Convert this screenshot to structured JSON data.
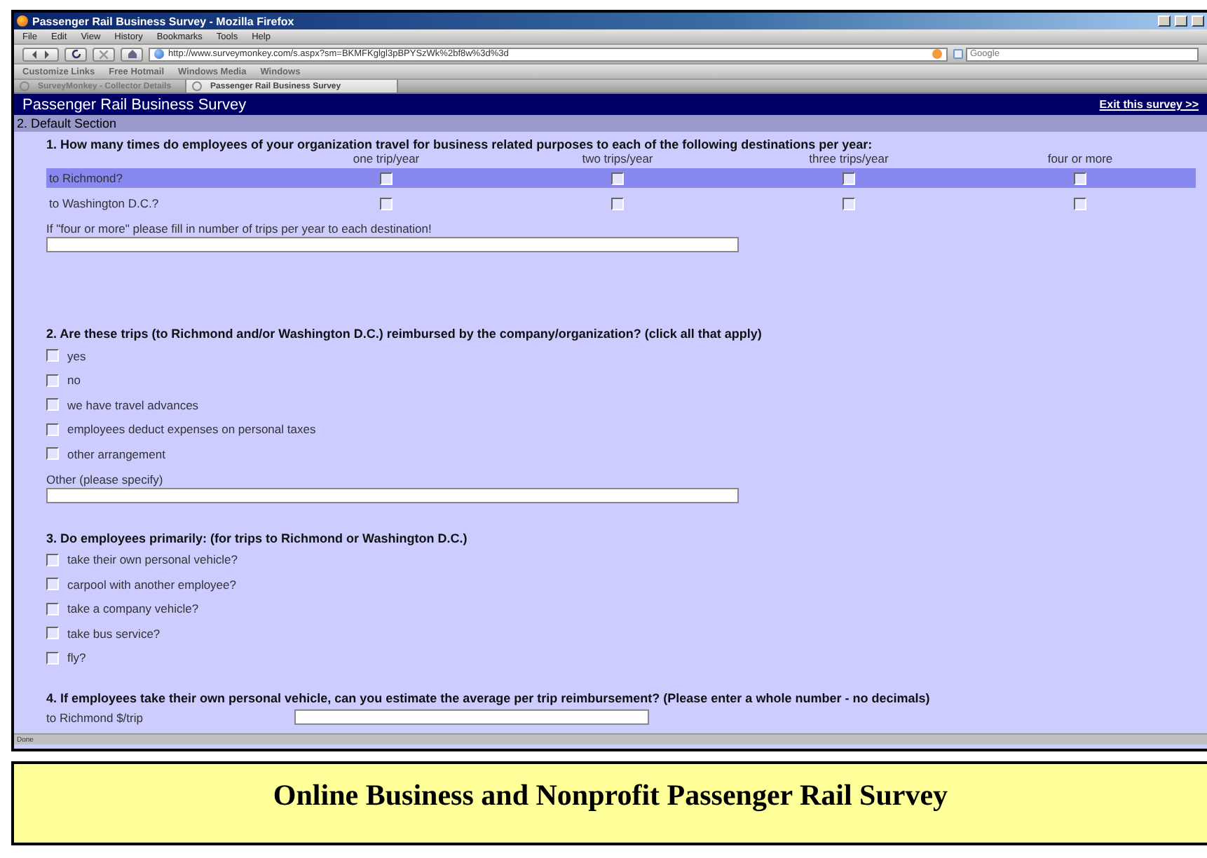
{
  "browser": {
    "title": "Passenger Rail Business Survey - Mozilla Firefox",
    "menu": [
      "File",
      "Edit",
      "View",
      "History",
      "Bookmarks",
      "Tools",
      "Help"
    ],
    "url": "http://www.surveymonkey.com/s.aspx?sm=BKMFKglgl3pBPYSzWk%2bf8w%3d%3d",
    "search_placeholder": "Google",
    "bookmarks": [
      "Customize Links",
      "Free Hotmail",
      "Windows Media",
      "Windows"
    ],
    "tabs": [
      {
        "label": "SurveyMonkey - Collector Details",
        "selected": false
      },
      {
        "label": "Passenger Rail Business Survey",
        "selected": true
      }
    ],
    "status": "Done"
  },
  "survey": {
    "title": "Passenger Rail Business Survey",
    "exit_link": "Exit this survey >>",
    "section": "2. Default Section",
    "questions": [
      {
        "kind": "matrix",
        "text": "1. How many times do employees of your organization travel for business related purposes to each of the following destinations per year:",
        "columns": [
          "one trip/year",
          "two trips/year",
          "three trips/year",
          "four or more"
        ],
        "rows": [
          {
            "label": "to Richmond?",
            "highlighted": true,
            "cells": [
              {
                "checked": false
              },
              {
                "checked": false
              },
              {
                "checked": false
              },
              {
                "checked": false
              }
            ]
          },
          {
            "label": "to Washington D.C.?",
            "highlighted": false,
            "cells": [
              {
                "checked": false
              },
              {
                "checked": false
              },
              {
                "checked": false
              },
              {
                "checked": false
              }
            ]
          }
        ],
        "field_label": "If \"four or more\" please fill in number of trips per year to each destination!"
      },
      {
        "kind": "checklist",
        "text": "2. Are these trips (to Richmond and/or Washington D.C.) reimbursed by the company/organization? (click all that apply)",
        "options": [
          {
            "label": "yes",
            "checked": false
          },
          {
            "label": "no",
            "checked": false
          },
          {
            "label": "we have travel advances",
            "checked": false
          },
          {
            "label": "employees deduct expenses on personal taxes",
            "checked": false
          },
          {
            "label": "other arrangement",
            "checked": false
          }
        ],
        "field_label": "Other (please specify)"
      },
      {
        "kind": "checklist",
        "text": "3. Do employees primarily: (for trips to Richmond or Washington D.C.)",
        "options": [
          {
            "label": "take their own personal vehicle?",
            "checked": false
          },
          {
            "label": "carpool with another employee?",
            "checked": false
          },
          {
            "label": "take a company vehicle?",
            "checked": false
          },
          {
            "label": "take bus service?",
            "checked": false
          },
          {
            "label": "fly?",
            "checked": false
          }
        ]
      },
      {
        "kind": "inputs",
        "text": "4. If employees take their own personal vehicle, can you estimate the average per trip reimbursement? (Please enter a whole number - no decimals)",
        "fields": [
          {
            "label": "to Richmond $/trip"
          }
        ]
      }
    ]
  },
  "caption": "Online Business and Nonprofit Passenger Rail Survey"
}
